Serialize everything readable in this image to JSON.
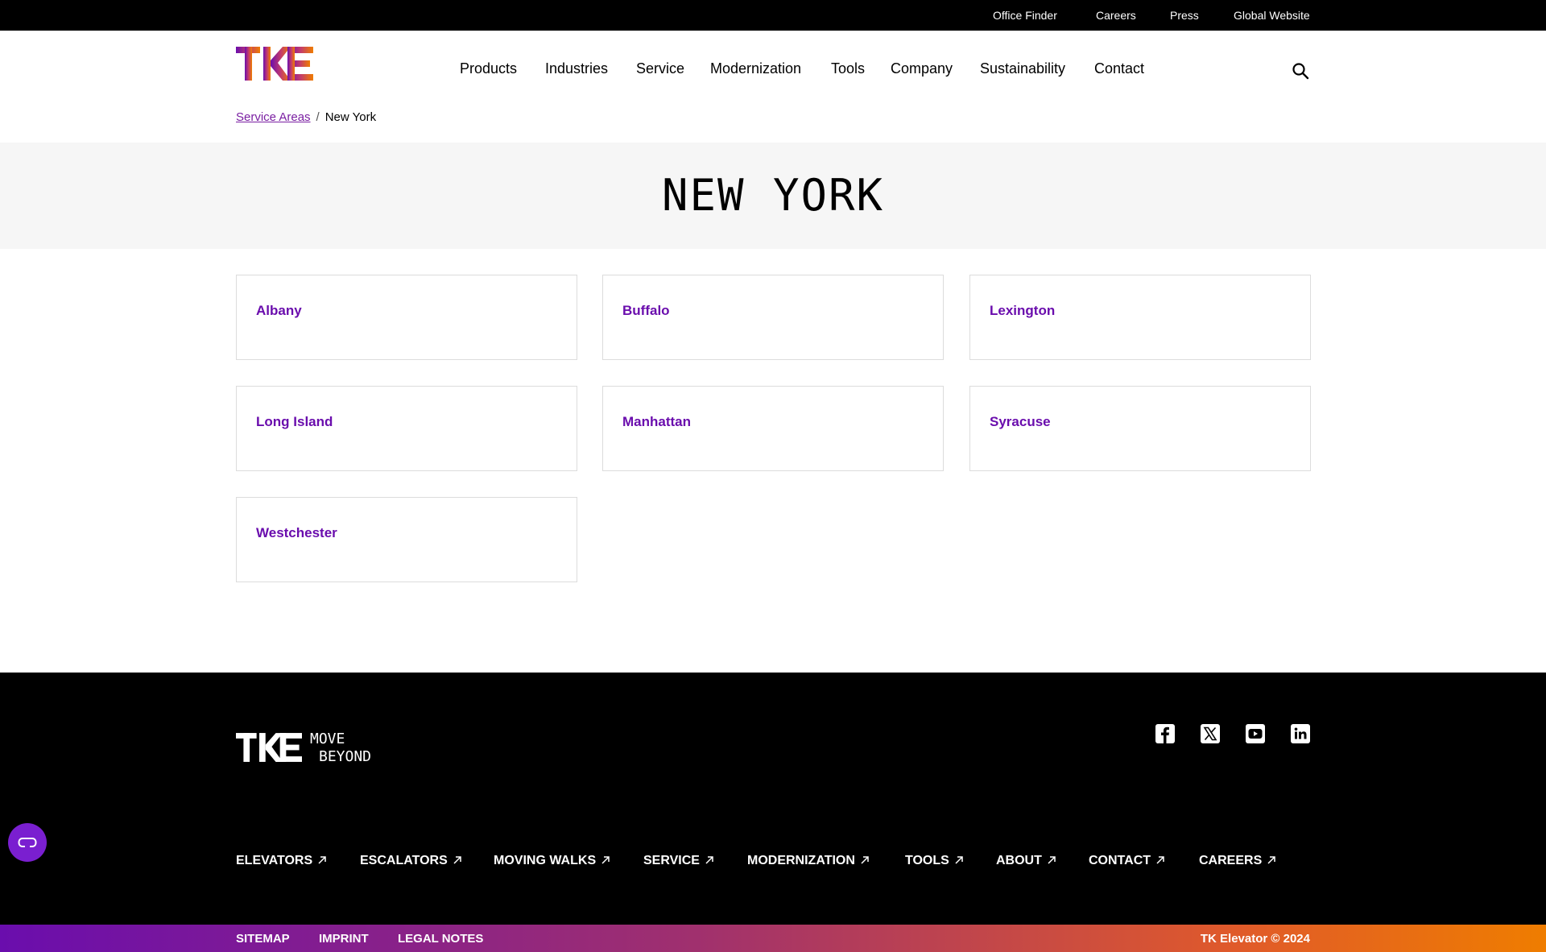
{
  "topbar": {
    "links": [
      "Office Finder",
      "Careers",
      "Press",
      "Global Website"
    ]
  },
  "header": {
    "logo_text": "TKE",
    "nav": [
      "Products",
      "Industries",
      "Service",
      "Modernization",
      "Tools",
      "Company",
      "Sustainability",
      "Contact"
    ],
    "search_icon": "search-icon"
  },
  "breadcrumb": {
    "parent": "Service Areas",
    "separator": "/",
    "current": "New York"
  },
  "hero": {
    "title": "NEW YORK"
  },
  "areas": [
    "Albany",
    "Buffalo",
    "Lexington",
    "Long Island",
    "Manhattan",
    "Syracuse",
    "Westchester"
  ],
  "footer": {
    "logo_text": "TKE",
    "tagline_line1": "MOVE",
    "tagline_line2": "BEYOND",
    "social_icons": [
      "facebook-icon",
      "x-icon",
      "youtube-icon",
      "linkedin-icon"
    ],
    "nav": [
      "ELEVATORS",
      "ESCALATORS",
      "MOVING WALKS",
      "SERVICE",
      "MODERNIZATION",
      "TOOLS",
      "ABOUT",
      "CONTACT",
      "CAREERS"
    ],
    "bottom_links": [
      "SITEMAP",
      "IMPRINT",
      "LEGAL NOTES"
    ],
    "copyright": "TK Elevator © 2024"
  },
  "colors": {
    "accent": "#6a0dad",
    "brand_orange": "#ef7d00",
    "footer_bg": "#000000",
    "hero_bg": "#f6f6f6"
  }
}
